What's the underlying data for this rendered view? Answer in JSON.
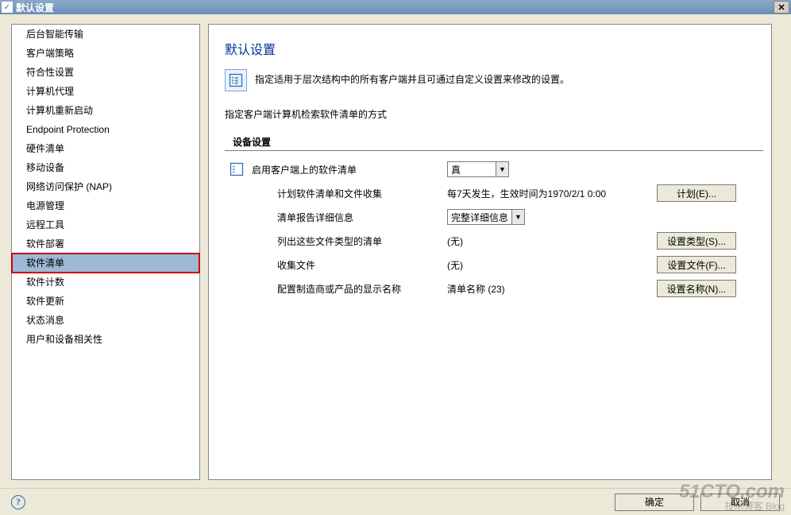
{
  "window": {
    "title": "默认设置"
  },
  "sidebar": {
    "items": [
      {
        "label": "后台智能传输",
        "selected": false
      },
      {
        "label": "客户端策略",
        "selected": false
      },
      {
        "label": "符合性设置",
        "selected": false
      },
      {
        "label": "计算机代理",
        "selected": false
      },
      {
        "label": "计算机重新启动",
        "selected": false
      },
      {
        "label": "Endpoint Protection",
        "selected": false
      },
      {
        "label": "硬件清单",
        "selected": false
      },
      {
        "label": "移动设备",
        "selected": false
      },
      {
        "label": "网络访问保护 (NAP)",
        "selected": false
      },
      {
        "label": "电源管理",
        "selected": false
      },
      {
        "label": "远程工具",
        "selected": false
      },
      {
        "label": "软件部署",
        "selected": false
      },
      {
        "label": "软件清单",
        "selected": true,
        "highlighted": true
      },
      {
        "label": "软件计数",
        "selected": false
      },
      {
        "label": "软件更新",
        "selected": false
      },
      {
        "label": "状态消息",
        "selected": false
      },
      {
        "label": "用户和设备相关性",
        "selected": false
      }
    ]
  },
  "content": {
    "title": "默认设置",
    "description": "指定适用于层次结构中的所有客户端并且可通过自定义设置来修改的设置。",
    "sub_description": "指定客户端计算机检索软件清单的方式",
    "section_label": "设备设置",
    "rows": [
      {
        "label": "启用客户端上的软件清单",
        "value_type": "dropdown",
        "value": "真"
      },
      {
        "label": "计划软件清单和文件收集",
        "value_type": "text",
        "value": "每7天发生，生效时间为1970/2/1 0:00",
        "button": "计划(E)..."
      },
      {
        "label": "清单报告详细信息",
        "value_type": "dropdown",
        "value": "完整详细信息"
      },
      {
        "label": "列出这些文件类型的清单",
        "value_type": "text",
        "value": "(无)",
        "button": "设置类型(S)..."
      },
      {
        "label": "收集文件",
        "value_type": "text",
        "value": "(无)",
        "button": "设置文件(F)..."
      },
      {
        "label": "配置制造商或产品的显示名称",
        "value_type": "text",
        "value": "清单名称 (23)",
        "button": "设置名称(N)..."
      }
    ]
  },
  "bottom": {
    "ok": "确定",
    "cancel": "取消"
  },
  "watermark": {
    "big": "51CTO.com",
    "small": "技术博客   Blog"
  }
}
